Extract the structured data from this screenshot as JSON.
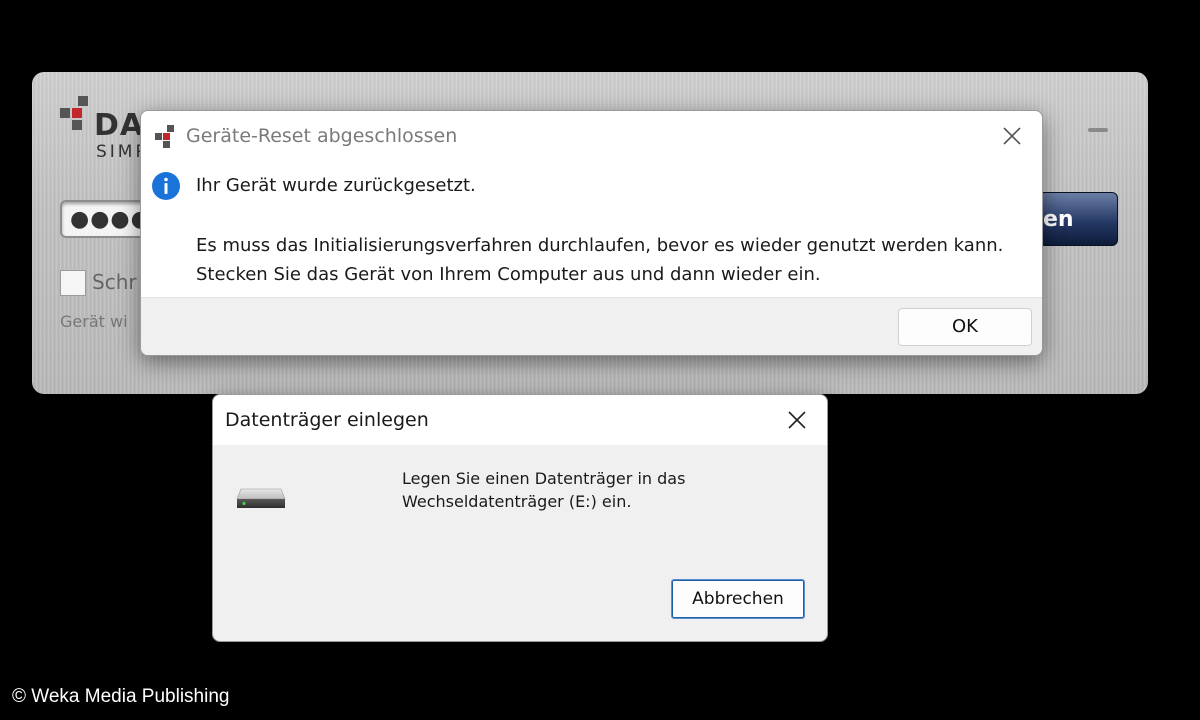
{
  "app": {
    "logo_text": "DA",
    "logo_subtext": "SIMP",
    "password_mask": "●●●●●",
    "button_label_partial": "en",
    "checkbox_label_partial": "Schr",
    "status_text_partial": "Gerät wi"
  },
  "reset_dialog": {
    "title": "Geräte-Reset abgeschlossen",
    "message_primary": "Ihr Gerät wurde zurückgesetzt.",
    "message_secondary": "Es muss das Initialisierungsverfahren durchlaufen, bevor es wieder genutzt werden kann. Stecken Sie das Gerät von Ihrem Computer aus und dann wieder ein.",
    "ok_label": "OK",
    "icons": {
      "title": "app-logo-icon",
      "info": "info-icon",
      "close": "close-icon"
    }
  },
  "insert_dialog": {
    "title": "Datenträger einlegen",
    "message_line1": "Legen Sie einen Datenträger in das",
    "message_line2": "Wechseldatenträger (E:) ein.",
    "cancel_label": "Abbrechen",
    "icons": {
      "drive": "removable-drive-icon",
      "close": "close-icon"
    }
  },
  "copyright": "© Weka Media Publishing",
  "colors": {
    "info_blue": "#1a73d9",
    "logo_red": "#c0282d",
    "logo_dark": "#333333",
    "button_navy": "#263a66"
  }
}
